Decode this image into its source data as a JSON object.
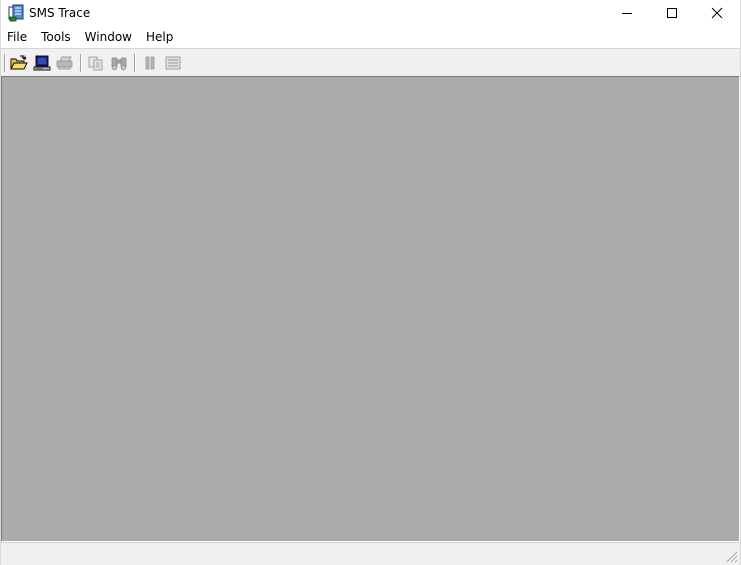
{
  "window": {
    "title": "SMS Trace"
  },
  "caption_buttons": {
    "minimize_icon": "minimize-icon",
    "maximize_icon": "maximize-icon",
    "close_icon": "close-icon"
  },
  "menu": {
    "items": [
      "File",
      "Tools",
      "Window",
      "Help"
    ]
  },
  "toolbar": {
    "buttons": [
      {
        "icon": "open-folder-icon",
        "enabled": true
      },
      {
        "icon": "computer-icon",
        "enabled": true
      },
      {
        "icon": "print-icon",
        "enabled": false
      },
      {
        "icon": "copy-icon",
        "enabled": false
      },
      {
        "icon": "find-icon",
        "enabled": false
      },
      {
        "icon": "pause-icon",
        "enabled": false
      },
      {
        "icon": "list-icon",
        "enabled": false
      }
    ]
  },
  "colors": {
    "mdi_background": "#ababab",
    "chrome_background": "#f0f0f0"
  },
  "statusbar": {
    "text": ""
  }
}
